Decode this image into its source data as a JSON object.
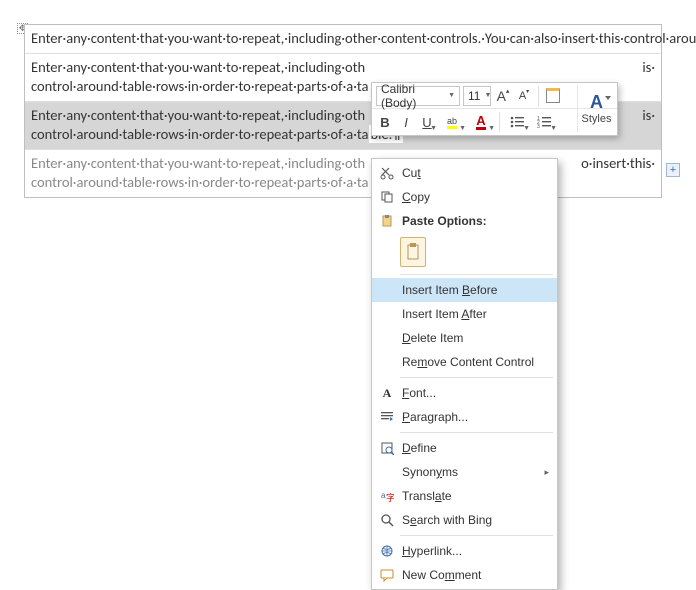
{
  "document": {
    "row1": "Enter·any·content·that·you·want·to·repeat,·including·other·content·controls.·You·can·also·insert·this·control·around·table·rows·in·order·to·repeat·parts·of·a·table.¶",
    "row2": "Enter·any·content·that·you·want·to·repeat,·including·other·content·controls.·You·can·also·insert·this·control·around·table·rows·in·order·to·repeat·parts·of·a·table.¶",
    "row3": "Enter·any·content·that·you·want·to·repeat,·including·other·content·controls.·You·can·also·insert·this·control·around·table·rows·in·order·to·repeat·parts·of·a·table.¶",
    "row4": "Enter·any·content·that·you·want·to·repeat,·including·other·content·controls.·You·can·also·insert·this·control·around·table·rows·in·order·to·repeat·parts·of·a·table.¶",
    "row2_vis": "Enter·any·content·that·you·want·to·repeat,·including·oth\ncontrol·around·table·rows·in·order·to·repeat·parts·of·a·ta",
    "row2_suffix": "is·",
    "row3_vis_a": "Enter·any·content·that·you·want·to·repeat,·including·oth",
    "row3_suffix_a": "is·",
    "row3_vis_b": "control·around·table·rows·in·order·to·repeat·parts·of·a·ta",
    "row4_vis_a": "Enter·any·content·that·you·want·to·repeat,·including·oth",
    "row4_suffix_a": "o·insert·this·",
    "row4_vis_b": "control·around·table·rows·in·order·to·repeat·parts·of·a·ta"
  },
  "miniToolbar": {
    "fontName": "Calibri (Body)",
    "fontSize": "11",
    "bold": "B",
    "italic": "I",
    "underline": "U",
    "stylesLabel": "Styles",
    "growA": "A",
    "shrinkA": "A",
    "fontColorA": "A",
    "highlightGlyph": "ab"
  },
  "contextMenu": {
    "cut": "Cut",
    "copy": "Copy",
    "pasteOptions": "Paste Options:",
    "insertBefore_pre": "Insert Item ",
    "insertBefore_u": "B",
    "insertBefore_post": "efore",
    "insertAfter_pre": "Insert Item ",
    "insertAfter_u": "A",
    "insertAfter_post": "fter",
    "deleteItem_u": "D",
    "deleteItem_post": "elete Item",
    "removeCC_pre": "Re",
    "removeCC_u": "m",
    "removeCC_post": "ove Content Control",
    "font_u": "F",
    "font_post": "ont...",
    "paragraph_u": "P",
    "paragraph_post": "aragraph...",
    "define_u": "D",
    "define_post": "efine",
    "synonyms_pre": "Synon",
    "synonyms_u": "y",
    "synonyms_post": "ms",
    "translate_pre": "Transl",
    "translate_u": "a",
    "translate_post": "te",
    "search_pre": "S",
    "search_u": "e",
    "search_post": "arch with Bing",
    "hyperlink_u": "H",
    "hyperlink_post": "yperlink...",
    "newComment_pre": "New Co",
    "newComment_u": "m",
    "newComment_post": "ment"
  },
  "glyphs": {
    "handle": "✥",
    "plus": "+",
    "chevron": "▸"
  }
}
